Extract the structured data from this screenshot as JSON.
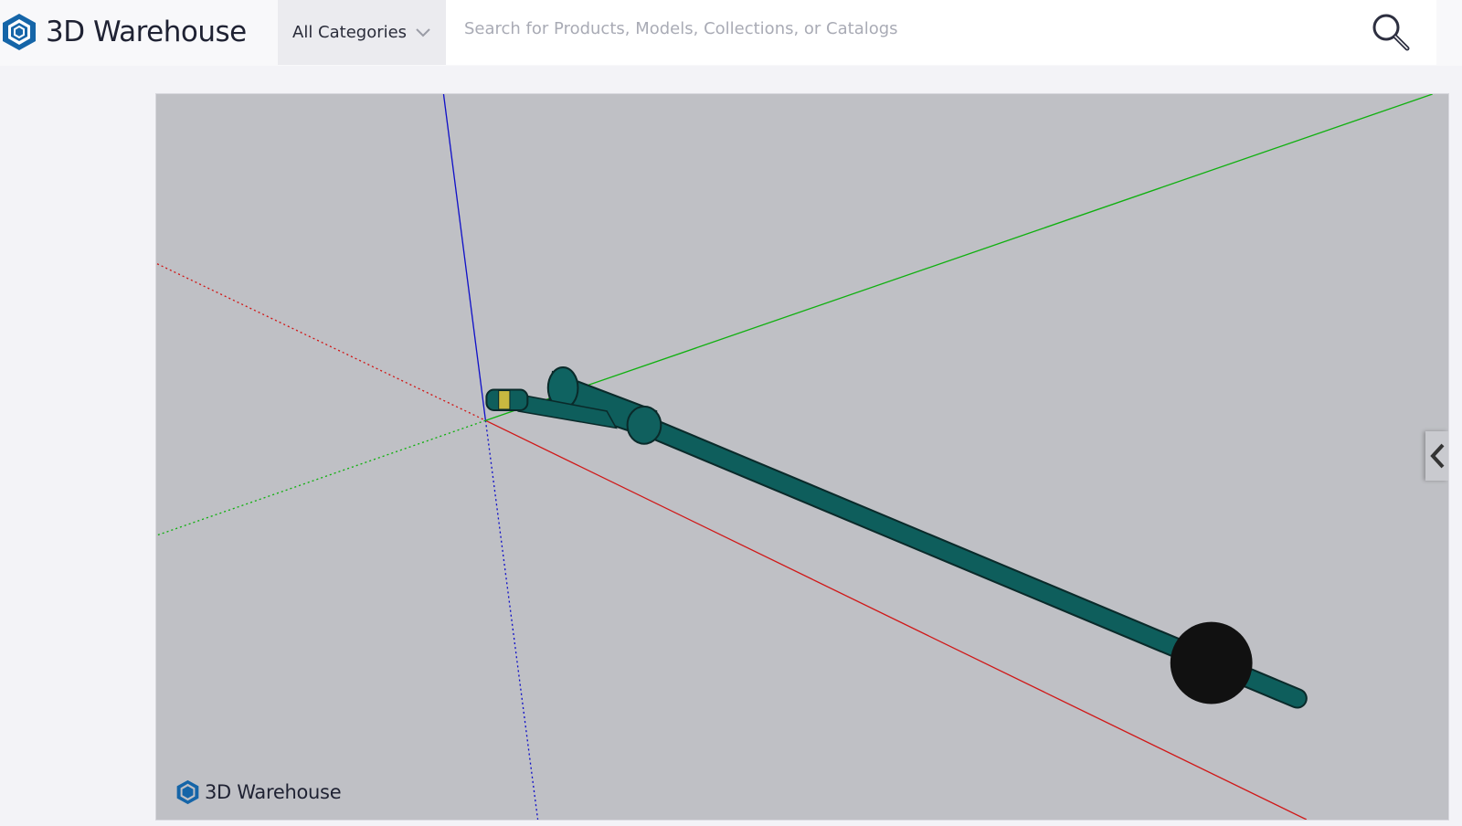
{
  "header": {
    "brand": "3D Warehouse",
    "category_select": "All Categories",
    "search_placeholder": "Search for Products, Models, Collections, or Catalogs"
  },
  "viewer": {
    "watermark": "3D Warehouse",
    "colors": {
      "background": "#bfc0c5",
      "model": "#0e5e5c",
      "band": "#c8b840",
      "tip": "#111111",
      "x_axis": "#d01818",
      "y_axis": "#10b010",
      "z_axis": "#1010c8"
    }
  }
}
